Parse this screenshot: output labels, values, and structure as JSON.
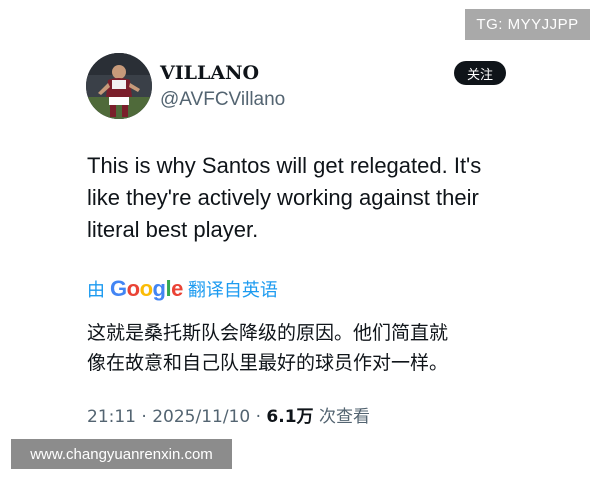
{
  "overlay": {
    "tg_badge": "TG: MYYJJPP",
    "watermark": "www.changyuanrenxin.com"
  },
  "author": {
    "display_name": "VILLANO",
    "handle": "@AVFCVillano",
    "follow_label": "关注"
  },
  "tweet": {
    "text_lines": [
      "This is why Santos will get relegated. It's",
      "like they're actively working against their",
      "literal best player."
    ]
  },
  "translation": {
    "prefix": "由",
    "google_letters": [
      "G",
      "o",
      "o",
      "g",
      "l",
      "e"
    ],
    "suffix": "翻译自英语",
    "text_lines": [
      "这就是桑托斯队会降级的原因。他们简直就",
      "像在故意和自己队里最好的球员作对一样。"
    ]
  },
  "meta": {
    "time": "21:11",
    "separator1": " · ",
    "date": "2025/11/10",
    "separator2": " · ",
    "views": "6.1万",
    "views_label": " 次查看"
  },
  "colors": {
    "link_blue": "#1d9bf0",
    "secondary_gray": "#536471",
    "primary_text": "#0f1419"
  },
  "icons": {
    "avatar": "player-photo-avatar"
  }
}
